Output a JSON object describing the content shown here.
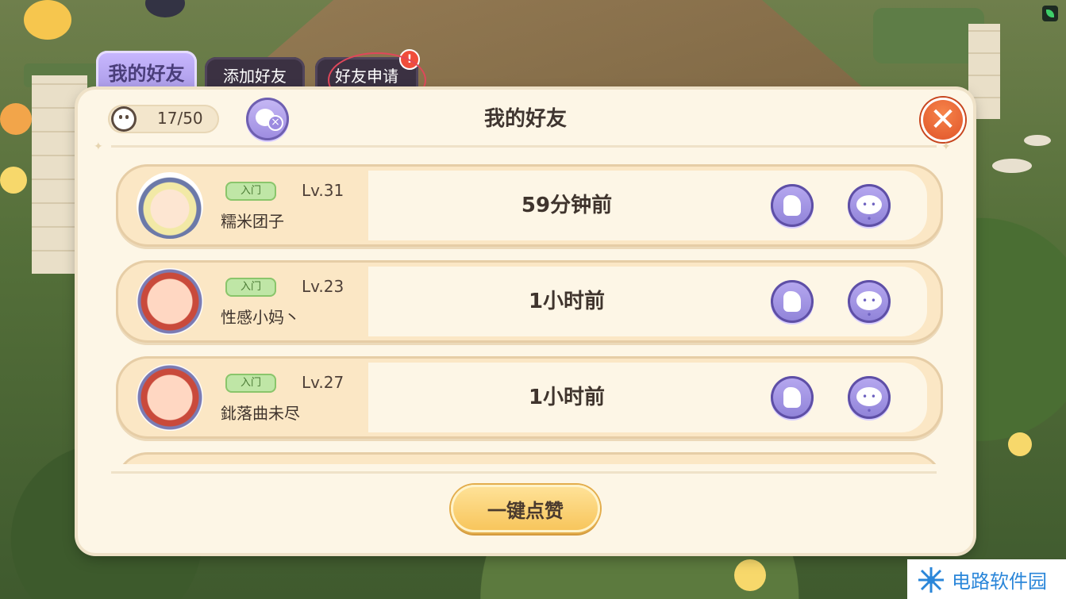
{
  "tabs": [
    {
      "label": "我的好友",
      "active": true
    },
    {
      "label": "添加好友",
      "active": false
    },
    {
      "label": "好友申请",
      "active": false,
      "badge": "!"
    }
  ],
  "panel": {
    "title": "我的好友",
    "friend_count": "17/50",
    "close_icon": "close-icon"
  },
  "friends": [
    {
      "rank": "入门",
      "level": "Lv.31",
      "name": "糯米团子",
      "last_online": "59分钟前"
    },
    {
      "rank": "入门",
      "level": "Lv.23",
      "name": "性感小妈丶",
      "last_online": "1小时前"
    },
    {
      "rank": "入门",
      "level": "Lv.27",
      "name": "鉳落曲未尽",
      "last_online": "1小时前"
    }
  ],
  "footer": {
    "like_all_label": "一键点赞"
  },
  "watermark": {
    "text": "电路软件园"
  },
  "colors": {
    "accent": "#a99ae6",
    "close": "#de4f26",
    "panel_bg": "#fdf6e6",
    "row_bg": "#fbe7c5",
    "badge_green": "#bfe6a6"
  }
}
